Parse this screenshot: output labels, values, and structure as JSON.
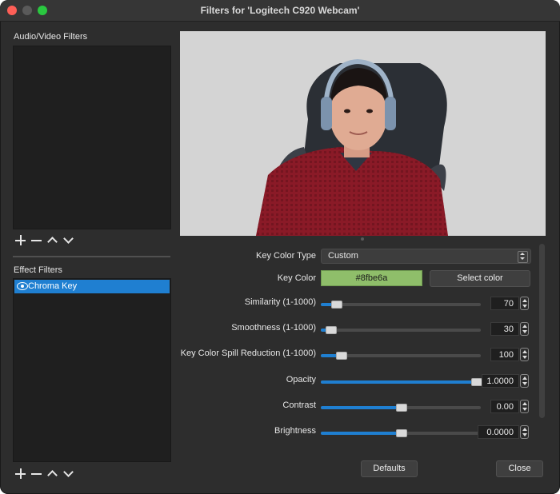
{
  "window": {
    "title": "Filters for 'Logitech C920 Webcam'",
    "traffic_colors": {
      "close": "#fe5f57",
      "minimize": "#5a5a5a",
      "maximize": "#2ac840"
    }
  },
  "sidebar": {
    "av_filters_label": "Audio/Video Filters",
    "effect_filters_label": "Effect Filters",
    "effect_filters": [
      {
        "label": "Chroma Key",
        "selected": true,
        "visible_icon": "eye-icon"
      }
    ],
    "toolbar_icons": [
      "plus-icon",
      "minus-icon",
      "chevron-up-icon",
      "chevron-down-icon"
    ]
  },
  "preview": {
    "background_color": "#d4d4d4",
    "description_icon": "webcam-preview"
  },
  "properties": {
    "key_color_type": {
      "label": "Key Color Type",
      "value": "Custom"
    },
    "key_color": {
      "label": "Key Color",
      "value": "#8fbe6a",
      "button_label": "Select color",
      "swatch_color": "#8fbe6a"
    },
    "sliders": [
      {
        "id": "similarity",
        "label": "Similarity (1-1000)",
        "value": "70",
        "fraction": 0.07
      },
      {
        "id": "smoothness",
        "label": "Smoothness (1-1000)",
        "value": "30",
        "fraction": 0.03
      },
      {
        "id": "spill",
        "label": "Key Color Spill Reduction (1-1000)",
        "value": "100",
        "fraction": 0.1
      },
      {
        "id": "opacity",
        "label": "Opacity",
        "value": "1.0000",
        "fraction": 1.0
      },
      {
        "id": "contrast",
        "label": "Contrast",
        "value": "0.00",
        "fraction": 0.5
      },
      {
        "id": "brightness",
        "label": "Brightness",
        "value": "0.0000",
        "fraction": 0.5
      }
    ]
  },
  "footer": {
    "defaults_label": "Defaults",
    "close_label": "Close"
  },
  "accent_color": "#1f7fd1"
}
